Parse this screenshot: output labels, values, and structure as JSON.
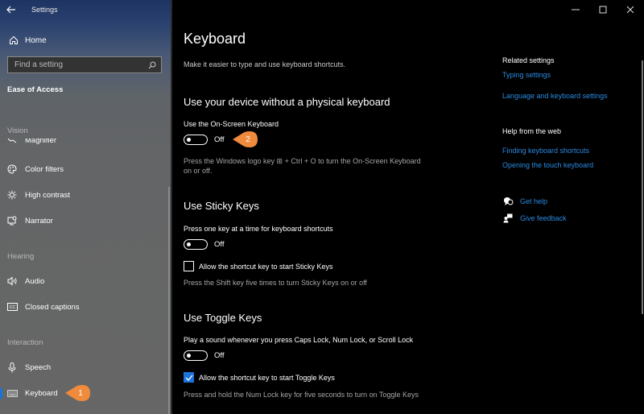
{
  "window": {
    "app_title": "Settings",
    "back_icon": "back-arrow-icon",
    "controls": {
      "minimize_icon": "minimize-icon",
      "maximize_icon": "maximize-icon",
      "close_icon": "close-icon"
    }
  },
  "sidebar": {
    "home_label": "Home",
    "search_placeholder": "Find a setting",
    "category": "Ease of Access",
    "groups": [
      {
        "label": "Vision",
        "items": [
          {
            "label": "Magnifier",
            "icon": "magnifier-icon"
          },
          {
            "label": "Color filters",
            "icon": "color-filters-icon"
          },
          {
            "label": "High contrast",
            "icon": "high-contrast-icon"
          },
          {
            "label": "Narrator",
            "icon": "narrator-icon"
          }
        ]
      },
      {
        "label": "Hearing",
        "items": [
          {
            "label": "Audio",
            "icon": "audio-icon"
          },
          {
            "label": "Closed captions",
            "icon": "closed-captions-icon"
          }
        ]
      },
      {
        "label": "Interaction",
        "items": [
          {
            "label": "Speech",
            "icon": "microphone-icon"
          },
          {
            "label": "Keyboard",
            "icon": "keyboard-icon",
            "selected": true
          }
        ]
      }
    ]
  },
  "callouts": {
    "first": "1",
    "second": "2",
    "color": "#f08a3c"
  },
  "main": {
    "title": "Keyboard",
    "description": "Make it easier to type and use keyboard shortcuts.",
    "sections": [
      {
        "title": "Use your device without a physical keyboard",
        "setting_label": "Use the On-Screen Keyboard",
        "toggle_state": "Off",
        "hint": "Press the Windows logo key ⊞ + Ctrl + O to turn the On-Screen Keyboard on or off."
      },
      {
        "title": "Use Sticky Keys",
        "setting_label": "Press one key at a time for keyboard shortcuts",
        "toggle_state": "Off",
        "checkbox_label": "Allow the shortcut key to start Sticky Keys",
        "checkbox_checked": false,
        "hint": "Press the Shift key five times to turn Sticky Keys on or off"
      },
      {
        "title": "Use Toggle Keys",
        "setting_label": "Play a sound whenever you press Caps Lock, Num Lock, or Scroll Lock",
        "toggle_state": "Off",
        "checkbox_label": "Allow the shortcut key to start Toggle Keys",
        "checkbox_checked": true,
        "hint": "Press and hold the Num Lock key for five seconds to turn on Toggle Keys"
      }
    ]
  },
  "related": {
    "heading": "Related settings",
    "links": [
      "Typing settings",
      "Language and keyboard settings"
    ]
  },
  "help_web": {
    "heading": "Help from the web",
    "links": [
      "Finding keyboard shortcuts",
      "Opening the touch keyboard"
    ]
  },
  "support": {
    "get_help": "Get help",
    "give_feedback": "Give feedback"
  },
  "colors": {
    "accent": "#1a73d9",
    "link": "#2a8ae0",
    "callout": "#f08a3c"
  }
}
